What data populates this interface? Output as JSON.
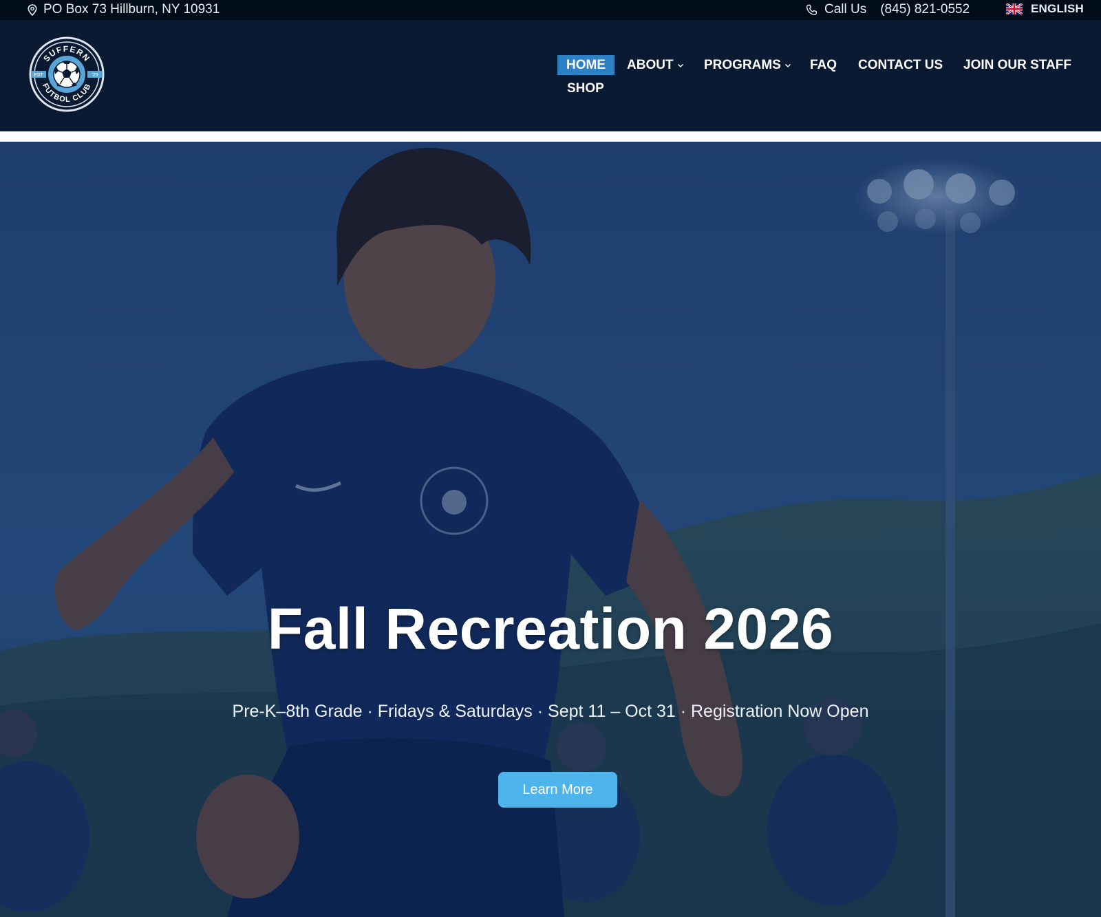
{
  "topbar": {
    "address": "PO Box 73 Hillburn, NY 10931",
    "call_label": "Call Us",
    "phone": "(845) 821-0552",
    "language": "ENGLISH",
    "icons": [
      "map-pin-icon",
      "phone-icon",
      "uk-flag-icon"
    ]
  },
  "brand": {
    "logo_text_top": "SUFFERN",
    "logo_text_bottom": "FUTBOL CLUB",
    "logo_left": "EST",
    "logo_right": "'25"
  },
  "nav": {
    "items": [
      {
        "label": "HOME",
        "active": true
      },
      {
        "label": "ABOUT",
        "has_dropdown": true
      },
      {
        "label": "PROGRAMS",
        "has_dropdown": true
      },
      {
        "label": "FAQ"
      },
      {
        "label": "CONTACT US"
      },
      {
        "label": "JOIN OUR STAFF"
      },
      {
        "label": "SHOP"
      }
    ]
  },
  "hero": {
    "title": "Fall Recreation 2026",
    "subtitle": "Pre-K–8th Grade · Fridays & Saturdays · Sept 11 – Oct 31 · Registration Now Open",
    "button_label": "Learn More"
  },
  "colors": {
    "topbar_bg": "#010c1b",
    "header_bg": "#0b1a33",
    "nav_active": "#2e80c4",
    "button": "#4db4ec"
  }
}
